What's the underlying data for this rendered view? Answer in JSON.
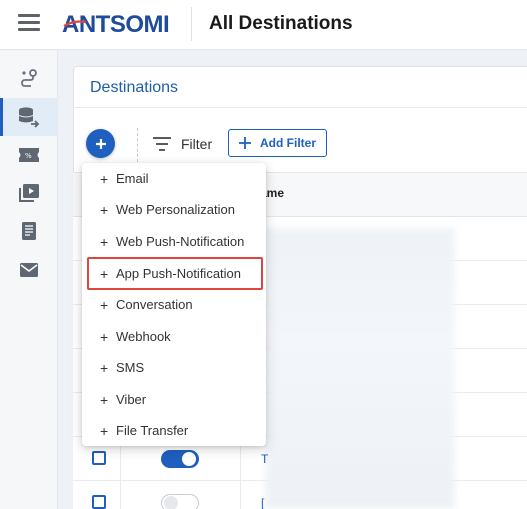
{
  "header": {
    "brand": "ANTSOMI",
    "title": "All Destinations"
  },
  "rail": {
    "items": [
      {
        "icon": "journey-route-icon",
        "active": false
      },
      {
        "icon": "database-export-icon",
        "active": true
      },
      {
        "icon": "ticket-icon",
        "active": false
      },
      {
        "icon": "video-library-icon",
        "active": false
      },
      {
        "icon": "document-list-icon",
        "active": false
      },
      {
        "icon": "mail-icon",
        "active": false
      }
    ]
  },
  "card": {
    "title": "Destinations"
  },
  "toolbar": {
    "filter_label": "Filter",
    "add_filter_label": "Add Filter"
  },
  "table": {
    "name_header_fragment": "ame",
    "rows": [
      {
        "checked": false,
        "toggle": "on",
        "name_fragment": "T"
      },
      {
        "checked": false,
        "toggle": "off",
        "name_fragment": "["
      }
    ]
  },
  "menu": {
    "items": [
      {
        "plus": "+",
        "label": "Email"
      },
      {
        "plus": "+",
        "label": "Web Personalization"
      },
      {
        "plus": "+",
        "label": "Web Push-Notification"
      },
      {
        "plus": "+",
        "label": "App Push-Notification"
      },
      {
        "plus": "+",
        "label": "Conversation"
      },
      {
        "plus": "+",
        "label": "Webhook"
      },
      {
        "plus": "+",
        "label": "SMS"
      },
      {
        "plus": "+",
        "label": "Viber"
      },
      {
        "plus": "+",
        "label": "File Transfer"
      }
    ],
    "highlighted_index": 3
  },
  "colors": {
    "brand_blue": "#1f5fbf",
    "highlight_red": "#e0443f"
  }
}
